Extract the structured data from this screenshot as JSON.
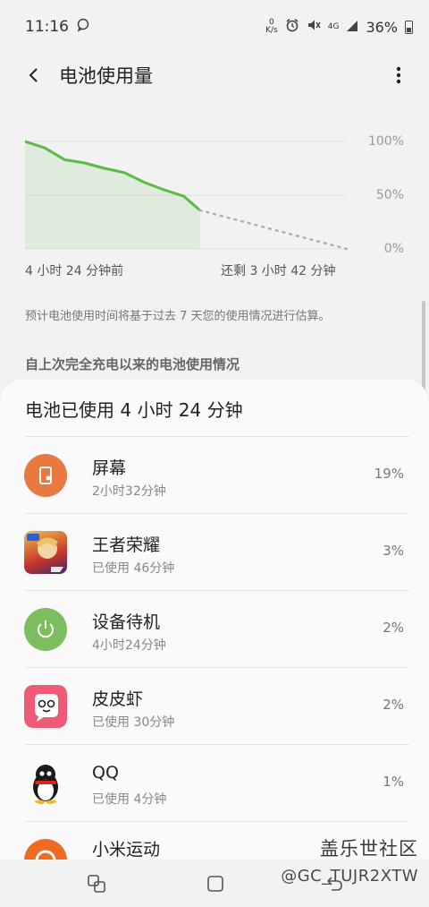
{
  "status_bar": {
    "time": "11:16",
    "net_speed_top": "0",
    "net_speed_bottom": "K/s",
    "network": "4G",
    "battery_percent": "36%"
  },
  "header": {
    "title": "电池使用量"
  },
  "chart_data": {
    "type": "line",
    "title": "",
    "x_start_label": "4 小时 24 分钟前",
    "x_end_label": "还剩 3 小时 42 分钟",
    "y_ticks": [
      "100%",
      "50%",
      "0%"
    ],
    "ylim": [
      0,
      100
    ],
    "grid": true,
    "series": [
      {
        "style": "solid-fill",
        "color": "#5cbb46",
        "x": [
          0,
          0.5,
          1,
          1.5,
          2,
          2.5,
          3,
          3.5,
          4,
          4.4
        ],
        "y": [
          100,
          94,
          83,
          80,
          75,
          71,
          62,
          55,
          49,
          36
        ]
      },
      {
        "style": "dotted-projection",
        "color": "#b0b0b0",
        "x": [
          4.4,
          8.1
        ],
        "y": [
          36,
          0
        ]
      }
    ]
  },
  "estimate_note": "预计电池使用时间将基于过去 7 天您的使用情况进行估算。",
  "section_heading": "自上次完全充电以来的电池使用情况",
  "usage": {
    "title": "电池已使用 4 小时 24 分钟",
    "apps": [
      {
        "name": "屏幕",
        "sub": "2小时32分钟",
        "percent": "19%",
        "icon": "screen-icon"
      },
      {
        "name": "王者荣耀",
        "sub": "已使用 46分钟",
        "percent": "3%",
        "icon": "honor-of-kings-icon"
      },
      {
        "name": "设备待机",
        "sub": "4小时24分钟",
        "percent": "2%",
        "icon": "power-standby-icon"
      },
      {
        "name": "皮皮虾",
        "sub": "已使用 30分钟",
        "percent": "2%",
        "icon": "pipixia-icon"
      },
      {
        "name": "QQ",
        "sub": "已使用 4分钟",
        "percent": "1%",
        "icon": "qq-penguin-icon"
      },
      {
        "name": "小米运动",
        "sub": "",
        "percent": "",
        "icon": "mi-fit-icon"
      }
    ]
  },
  "watermark": {
    "site": "盖乐世社区",
    "user": "@GC_TUJR2XTW"
  },
  "colors": {
    "accent_green": "#5cbb46",
    "screen_orange": "#e8793f",
    "standby_green": "#7cbd5d",
    "pipixia_pink": "#ef5a78"
  }
}
